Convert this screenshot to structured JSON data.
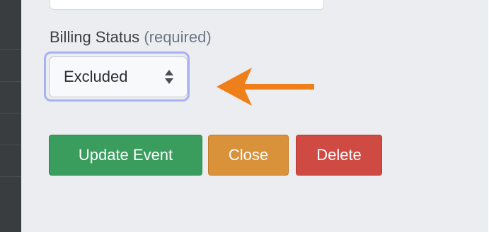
{
  "form": {
    "billing_status_label": "Billing Status",
    "billing_status_required": "(required)",
    "billing_status_value": "Excluded"
  },
  "buttons": {
    "update_label": "Update Event",
    "close_label": "Close",
    "delete_label": "Delete"
  },
  "annotation": {
    "arrow_color": "#ef7f1a"
  },
  "colors": {
    "update": "#3a9d5d",
    "close": "#d9913a",
    "delete": "#cf4a43",
    "focus_ring": "#a9b1f5"
  },
  "icons": {
    "select_caret": "sort-caret-icon",
    "pointer_arrow": "left-arrow-icon"
  }
}
